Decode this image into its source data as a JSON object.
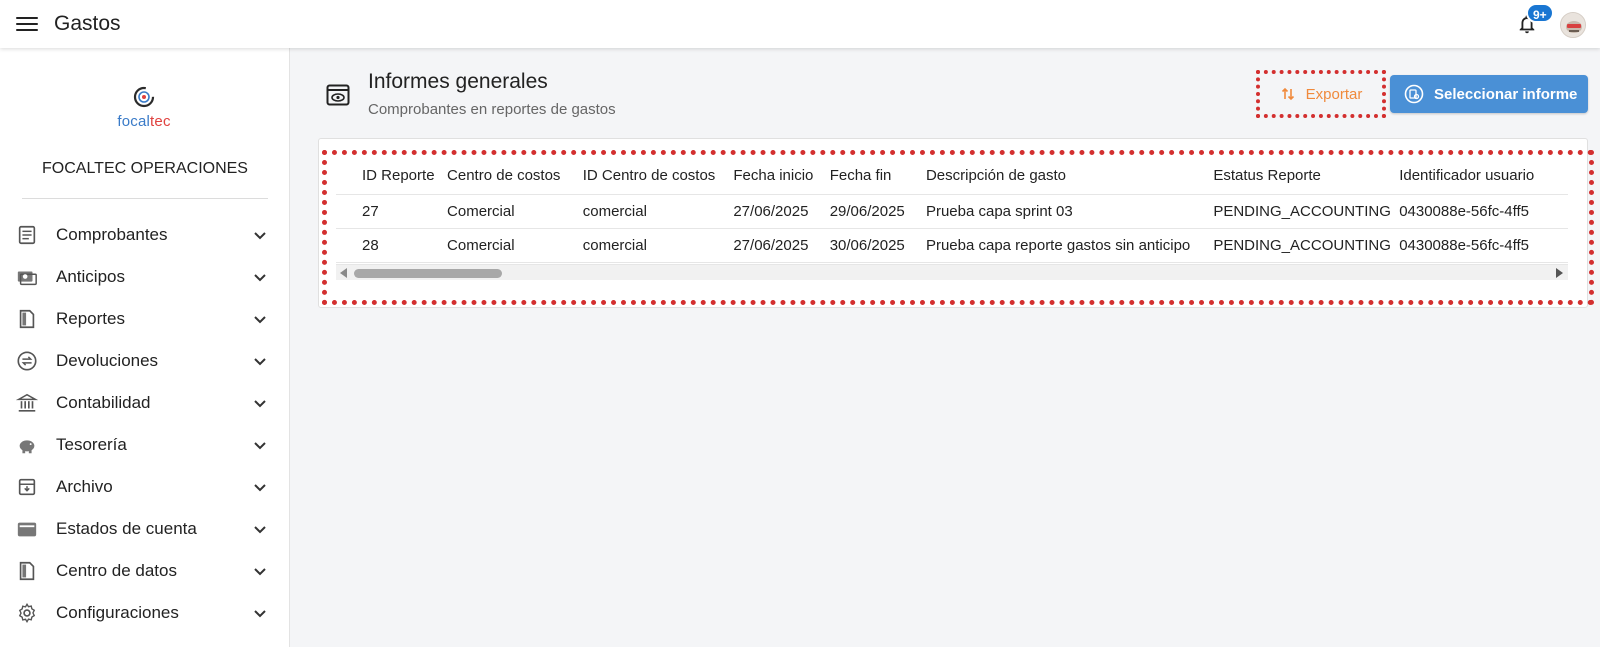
{
  "header": {
    "title": "Gastos",
    "notification_badge": "9+",
    "menu_icon": "menu-icon",
    "bell_icon": "bell-icon"
  },
  "sidebar": {
    "logo_text_a": "focal",
    "logo_text_b": "tec",
    "org_name": "FOCALTEC OPERACIONES",
    "items": [
      {
        "label": "Comprobantes",
        "icon": "document-list-icon"
      },
      {
        "label": "Anticipos",
        "icon": "cash-icon"
      },
      {
        "label": "Reportes",
        "icon": "report-icon"
      },
      {
        "label": "Devoluciones",
        "icon": "exchange-icon"
      },
      {
        "label": "Contabilidad",
        "icon": "bank-icon"
      },
      {
        "label": "Tesorería",
        "icon": "piggy-bank-icon"
      },
      {
        "label": "Archivo",
        "icon": "archive-icon"
      },
      {
        "label": "Estados de cuenta",
        "icon": "wallet-icon"
      },
      {
        "label": "Centro de datos",
        "icon": "data-file-icon"
      },
      {
        "label": "Configuraciones",
        "icon": "gear-icon"
      }
    ]
  },
  "main": {
    "title": "Informes generales",
    "subtitle": "Comprobantes en reportes de gastos",
    "export_label": "Exportar",
    "select_label": "Seleccionar informe"
  },
  "table": {
    "columns": [
      "ID Reporte",
      "Centro de costos",
      "ID Centro de costos",
      "Fecha inicio",
      "Fecha fin",
      "Descripción de gasto",
      "Estatus Reporte",
      "Identificador usuario"
    ],
    "rows": [
      [
        "27",
        "Comercial",
        "comercial",
        "27/06/2025",
        "29/06/2025",
        "Prueba capa sprint 03",
        "PENDING_ACCOUNTING",
        "0430088e-56fc-4ff5"
      ],
      [
        "28",
        "Comercial",
        "comercial",
        "27/06/2025",
        "30/06/2025",
        "Prueba capa reporte gastos sin anticipo",
        "PENDING_ACCOUNTING",
        "0430088e-56fc-4ff5"
      ]
    ]
  },
  "colors": {
    "accent_blue": "#4a90d6",
    "export_orange": "#f08a3c",
    "highlight_red": "#d32f2f",
    "badge_blue": "#1976d2"
  }
}
